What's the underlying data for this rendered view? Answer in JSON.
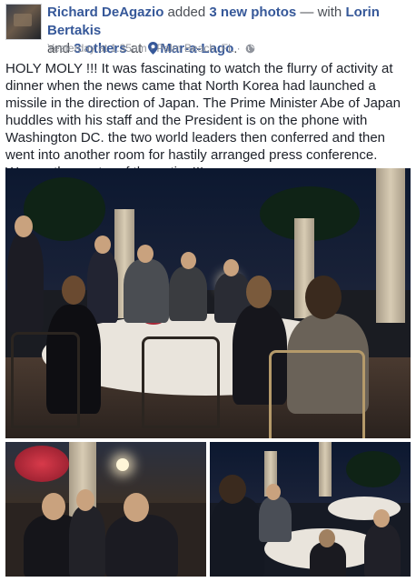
{
  "post": {
    "author": "Richard DeAgazio",
    "action_pre": " added ",
    "photo_count": "3 new photos",
    "with_text": " — with ",
    "tagged": "Lorin Bertakis",
    "and_text": "and ",
    "others": "3 others",
    "at_text": " at ",
    "place": "Mar-a-Lago",
    "place_end": ".",
    "timestamp": "Yesterday at 1:35am",
    "sep": " · ",
    "location": "Palm Beach, FL",
    "sep2": " · ",
    "body": "HOLY MOLY !!! It was fascinating to watch the flurry of activity at dinner when the news came that North Korea had launched a missile in the direction of Japan. The Prime Minister Abe of Japan huddles with his staff and the President is on the phone with Washington DC. the two world leaders then conferred and then went into another room for hastily arranged press conference. Wow.....the center of the action!!!"
  },
  "icons": {
    "place": "map-pin-icon",
    "privacy": "globe-icon"
  },
  "colors": {
    "link": "#365899",
    "meta": "#90949c",
    "text": "#1d2129"
  }
}
